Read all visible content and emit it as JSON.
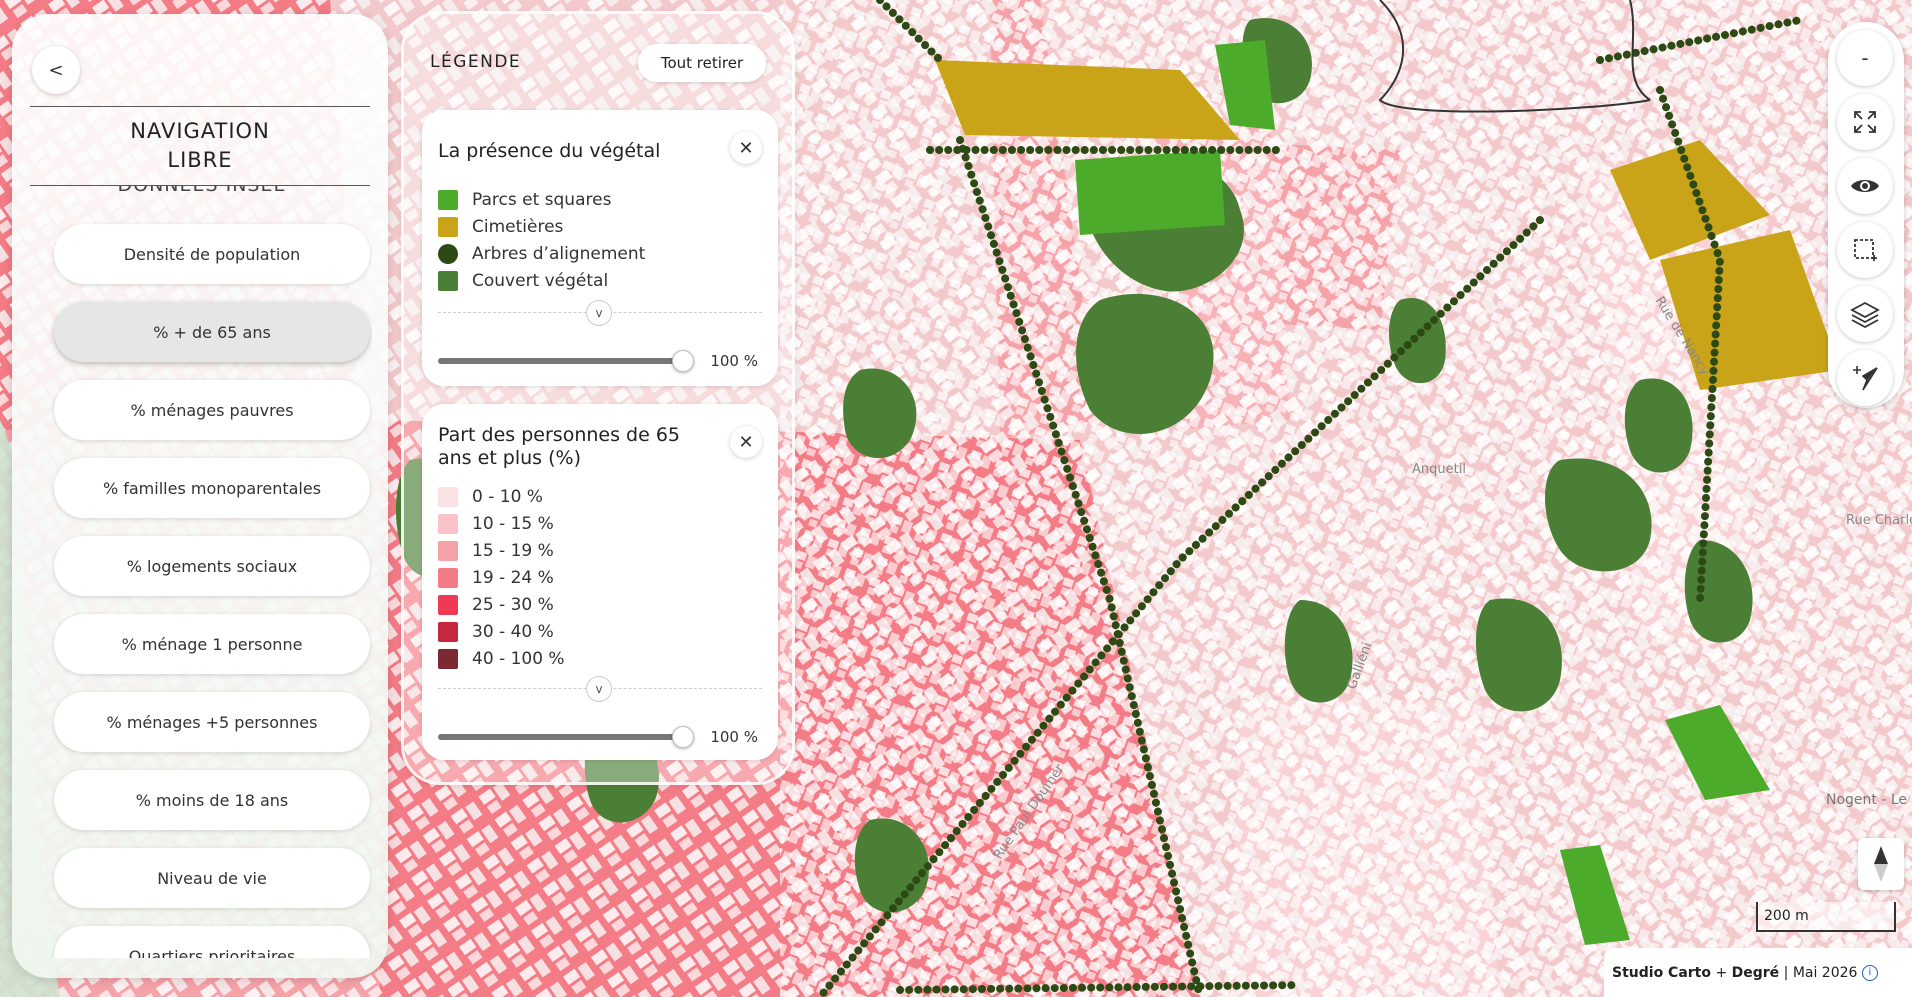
{
  "nav": {
    "back_label": "<",
    "title": "NAVIGATION LIBRE",
    "section_title": "DONNÉES INSEE",
    "indicators": [
      {
        "label": "Densité de population",
        "active": false
      },
      {
        "label": "% + de 65 ans",
        "active": true
      },
      {
        "label": "% ménages pauvres",
        "active": false
      },
      {
        "label": "% familles monoparentales",
        "active": false
      },
      {
        "label": "% logements sociaux",
        "active": false
      },
      {
        "label": "% ménage 1 personne",
        "active": false
      },
      {
        "label": "% ménages +5 personnes",
        "active": false
      },
      {
        "label": "% moins de 18 ans",
        "active": false
      },
      {
        "label": "Niveau de vie",
        "active": false
      },
      {
        "label": "Quartiers prioritaires",
        "active": false
      }
    ]
  },
  "legend": {
    "title": "LÉGENDE",
    "clear_all_label": "Tout retirer",
    "layers": [
      {
        "title": "La présence du végétal",
        "items": [
          {
            "label": "Parcs et squares",
            "color": "#4cab2a",
            "shape": "square"
          },
          {
            "label": "Cimetières",
            "color": "#c9a418",
            "shape": "square"
          },
          {
            "label": "Arbres d’alignement",
            "color": "#2d4a14",
            "shape": "circle"
          },
          {
            "label": "Couvert végétal",
            "color": "#4b7f35",
            "shape": "square"
          }
        ],
        "opacity": 1.0,
        "opacity_label": "100 %"
      },
      {
        "title": "Part des personnes de 65 ans et plus (%)",
        "items": [
          {
            "label": "0 - 10 %",
            "color": "#fbe3e5",
            "shape": "square"
          },
          {
            "label": "10 - 15 %",
            "color": "#f9c3c8",
            "shape": "square"
          },
          {
            "label": "15 - 19 %",
            "color": "#f6a2a9",
            "shape": "square"
          },
          {
            "label": "19 - 24 %",
            "color": "#f47c86",
            "shape": "square"
          },
          {
            "label": "25 - 30 %",
            "color": "#ee3a55",
            "shape": "square"
          },
          {
            "label": "30 - 40 %",
            "color": "#c5283f",
            "shape": "square"
          },
          {
            "label": "40 - 100 %",
            "color": "#7b2a34",
            "shape": "square"
          }
        ],
        "opacity": 1.0,
        "opacity_label": "100 %"
      }
    ]
  },
  "toolbar": {
    "zoom_out_label": "-",
    "icons": [
      "minus-icon",
      "fullscreen-icon",
      "eye-icon",
      "crop-select-icon",
      "layers-icon",
      "locate-icon"
    ]
  },
  "map": {
    "street_labels": [
      "Anquetil",
      "Rue de Nancy",
      "Rue Charles",
      "Nogent - Le Perreux",
      "Galliéni",
      "Rue Paul Doumer"
    ],
    "scale_label": "200 m",
    "attribution": {
      "studio": "Studio Carto",
      "plus": "+",
      "partner": "Degré",
      "date": "Mai 2026",
      "info_icon": "info-icon"
    }
  },
  "colors": {
    "choropleth_base": "#f3c9cc",
    "choropleth_mid": "#f47c86",
    "vegetation": "#4b7f35",
    "park": "#4cab2a",
    "cemetery": "#c9a418",
    "tree": "#2d4a14"
  }
}
